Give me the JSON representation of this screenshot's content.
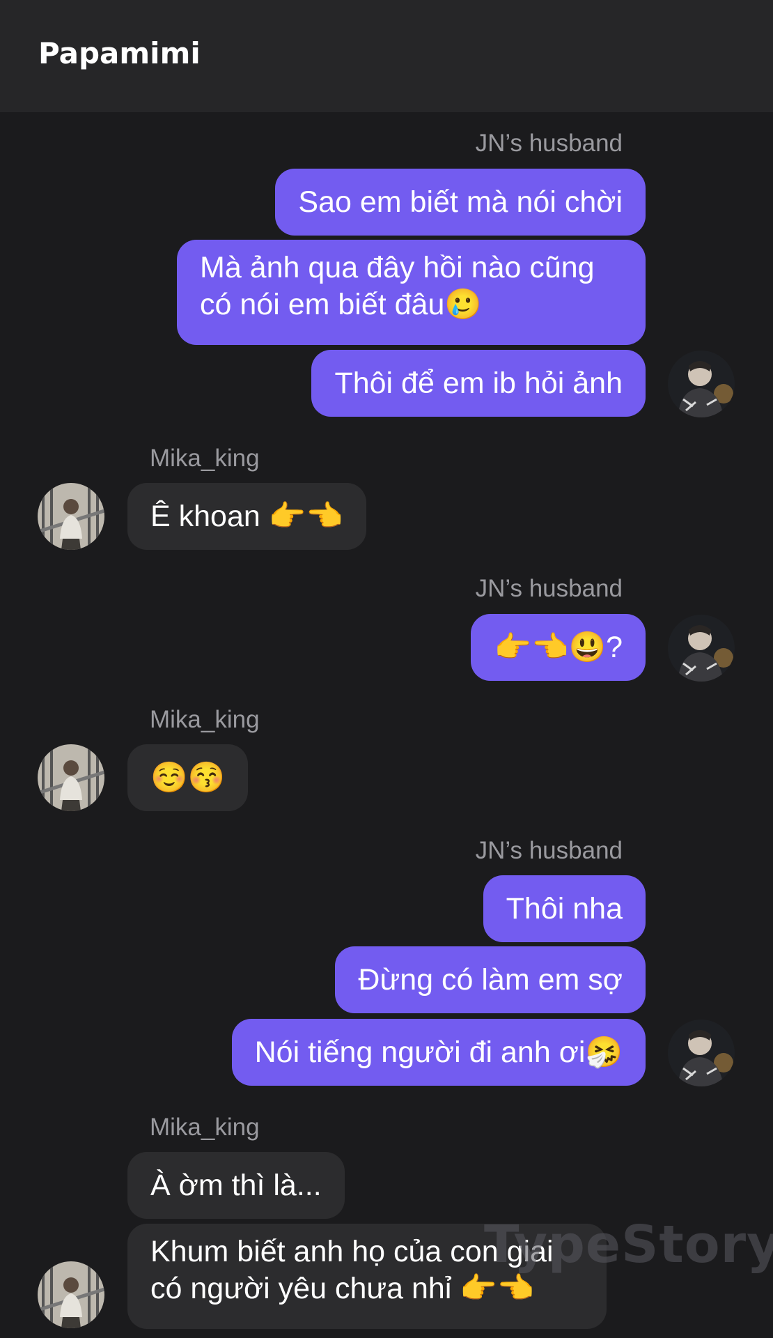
{
  "header": {
    "title": "Papamimi"
  },
  "watermark": "TypeStory",
  "participants": {
    "me": {
      "name": "JN’s husband"
    },
    "other": {
      "name": "Mika_king"
    }
  },
  "groups": [
    {
      "sender": "JN’s husband",
      "messages": [
        "Sao em biết mà nói chời",
        "Mà ảnh qua đây hồi nào cũng\ncó nói em biết đâu🥲",
        "Thôi để em ib hỏi ảnh"
      ]
    },
    {
      "sender": "Mika_king",
      "messages": [
        "Ê khoan 👉👈"
      ]
    },
    {
      "sender": "JN’s husband",
      "messages": [
        "👉👈😃?"
      ]
    },
    {
      "sender": "Mika_king",
      "messages": [
        "☺️😚"
      ]
    },
    {
      "sender": "JN’s husband",
      "messages": [
        "Thôi nha",
        "Đừng có làm em sợ",
        "Nói tiếng người đi anh ơi🤧"
      ]
    },
    {
      "sender": "Mika_king",
      "messages": [
        "À ờm thì là...",
        "Khum biết anh họ của con giai\ncó người yêu chưa nhỉ 👉👈"
      ]
    }
  ],
  "colors": {
    "background": "#1b1b1d",
    "header": "#262628",
    "outgoing_bubble": "#735cf0",
    "incoming_bubble": "#2c2c2e",
    "sender_name": "#9a9a9f"
  }
}
